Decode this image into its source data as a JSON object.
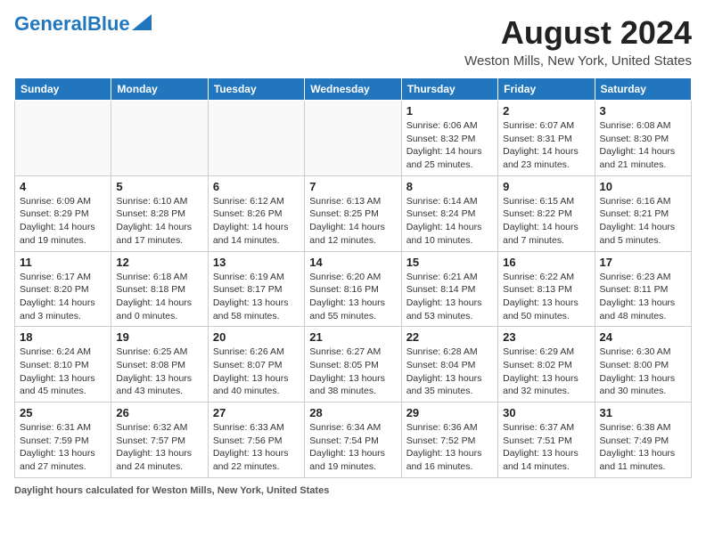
{
  "header": {
    "logo_general": "General",
    "logo_blue": "Blue",
    "month_title": "August 2024",
    "location": "Weston Mills, New York, United States"
  },
  "days_of_week": [
    "Sunday",
    "Monday",
    "Tuesday",
    "Wednesday",
    "Thursday",
    "Friday",
    "Saturday"
  ],
  "weeks": [
    [
      {
        "day": "",
        "sunrise": "",
        "sunset": "",
        "daylight": ""
      },
      {
        "day": "",
        "sunrise": "",
        "sunset": "",
        "daylight": ""
      },
      {
        "day": "",
        "sunrise": "",
        "sunset": "",
        "daylight": ""
      },
      {
        "day": "",
        "sunrise": "",
        "sunset": "",
        "daylight": ""
      },
      {
        "day": "1",
        "sunrise": "6:06 AM",
        "sunset": "8:32 PM",
        "daylight": "14 hours and 25 minutes."
      },
      {
        "day": "2",
        "sunrise": "6:07 AM",
        "sunset": "8:31 PM",
        "daylight": "14 hours and 23 minutes."
      },
      {
        "day": "3",
        "sunrise": "6:08 AM",
        "sunset": "8:30 PM",
        "daylight": "14 hours and 21 minutes."
      }
    ],
    [
      {
        "day": "4",
        "sunrise": "6:09 AM",
        "sunset": "8:29 PM",
        "daylight": "14 hours and 19 minutes."
      },
      {
        "day": "5",
        "sunrise": "6:10 AM",
        "sunset": "8:28 PM",
        "daylight": "14 hours and 17 minutes."
      },
      {
        "day": "6",
        "sunrise": "6:12 AM",
        "sunset": "8:26 PM",
        "daylight": "14 hours and 14 minutes."
      },
      {
        "day": "7",
        "sunrise": "6:13 AM",
        "sunset": "8:25 PM",
        "daylight": "14 hours and 12 minutes."
      },
      {
        "day": "8",
        "sunrise": "6:14 AM",
        "sunset": "8:24 PM",
        "daylight": "14 hours and 10 minutes."
      },
      {
        "day": "9",
        "sunrise": "6:15 AM",
        "sunset": "8:22 PM",
        "daylight": "14 hours and 7 minutes."
      },
      {
        "day": "10",
        "sunrise": "6:16 AM",
        "sunset": "8:21 PM",
        "daylight": "14 hours and 5 minutes."
      }
    ],
    [
      {
        "day": "11",
        "sunrise": "6:17 AM",
        "sunset": "8:20 PM",
        "daylight": "14 hours and 3 minutes."
      },
      {
        "day": "12",
        "sunrise": "6:18 AM",
        "sunset": "8:18 PM",
        "daylight": "14 hours and 0 minutes."
      },
      {
        "day": "13",
        "sunrise": "6:19 AM",
        "sunset": "8:17 PM",
        "daylight": "13 hours and 58 minutes."
      },
      {
        "day": "14",
        "sunrise": "6:20 AM",
        "sunset": "8:16 PM",
        "daylight": "13 hours and 55 minutes."
      },
      {
        "day": "15",
        "sunrise": "6:21 AM",
        "sunset": "8:14 PM",
        "daylight": "13 hours and 53 minutes."
      },
      {
        "day": "16",
        "sunrise": "6:22 AM",
        "sunset": "8:13 PM",
        "daylight": "13 hours and 50 minutes."
      },
      {
        "day": "17",
        "sunrise": "6:23 AM",
        "sunset": "8:11 PM",
        "daylight": "13 hours and 48 minutes."
      }
    ],
    [
      {
        "day": "18",
        "sunrise": "6:24 AM",
        "sunset": "8:10 PM",
        "daylight": "13 hours and 45 minutes."
      },
      {
        "day": "19",
        "sunrise": "6:25 AM",
        "sunset": "8:08 PM",
        "daylight": "13 hours and 43 minutes."
      },
      {
        "day": "20",
        "sunrise": "6:26 AM",
        "sunset": "8:07 PM",
        "daylight": "13 hours and 40 minutes."
      },
      {
        "day": "21",
        "sunrise": "6:27 AM",
        "sunset": "8:05 PM",
        "daylight": "13 hours and 38 minutes."
      },
      {
        "day": "22",
        "sunrise": "6:28 AM",
        "sunset": "8:04 PM",
        "daylight": "13 hours and 35 minutes."
      },
      {
        "day": "23",
        "sunrise": "6:29 AM",
        "sunset": "8:02 PM",
        "daylight": "13 hours and 32 minutes."
      },
      {
        "day": "24",
        "sunrise": "6:30 AM",
        "sunset": "8:00 PM",
        "daylight": "13 hours and 30 minutes."
      }
    ],
    [
      {
        "day": "25",
        "sunrise": "6:31 AM",
        "sunset": "7:59 PM",
        "daylight": "13 hours and 27 minutes."
      },
      {
        "day": "26",
        "sunrise": "6:32 AM",
        "sunset": "7:57 PM",
        "daylight": "13 hours and 24 minutes."
      },
      {
        "day": "27",
        "sunrise": "6:33 AM",
        "sunset": "7:56 PM",
        "daylight": "13 hours and 22 minutes."
      },
      {
        "day": "28",
        "sunrise": "6:34 AM",
        "sunset": "7:54 PM",
        "daylight": "13 hours and 19 minutes."
      },
      {
        "day": "29",
        "sunrise": "6:36 AM",
        "sunset": "7:52 PM",
        "daylight": "13 hours and 16 minutes."
      },
      {
        "day": "30",
        "sunrise": "6:37 AM",
        "sunset": "7:51 PM",
        "daylight": "13 hours and 14 minutes."
      },
      {
        "day": "31",
        "sunrise": "6:38 AM",
        "sunset": "7:49 PM",
        "daylight": "13 hours and 11 minutes."
      }
    ]
  ],
  "footer": {
    "label": "Daylight hours",
    "note": "calculated for Weston Mills, New York, United States"
  }
}
